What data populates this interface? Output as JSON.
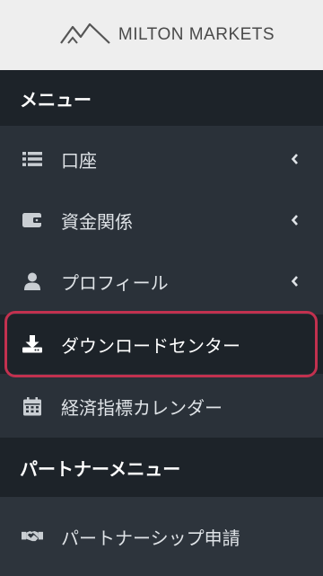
{
  "logo": {
    "brand": "MILTON MARKETS",
    "icon": "mountain-logo-icon"
  },
  "menu_header": "メニュー",
  "menu_items": [
    {
      "label": "口座",
      "icon": "list-icon",
      "has_chevron": true
    },
    {
      "label": "資金関係",
      "icon": "wallet-icon",
      "has_chevron": true
    },
    {
      "label": "プロフィール",
      "icon": "user-icon",
      "has_chevron": true
    },
    {
      "label": "ダウンロードセンター",
      "icon": "download-icon",
      "has_chevron": false,
      "active": true
    },
    {
      "label": "経済指標カレンダー",
      "icon": "calendar-icon",
      "has_chevron": false
    }
  ],
  "partner_header": "パートナーメニュー",
  "partner_items": [
    {
      "label": "パートナーシップ申請",
      "icon": "handshake-icon"
    }
  ],
  "colors": {
    "sidebar_bg": "#2a3139",
    "header_bg": "#1d2329",
    "highlight_border": "#c2314f",
    "logo_bg": "#eeeeee"
  }
}
